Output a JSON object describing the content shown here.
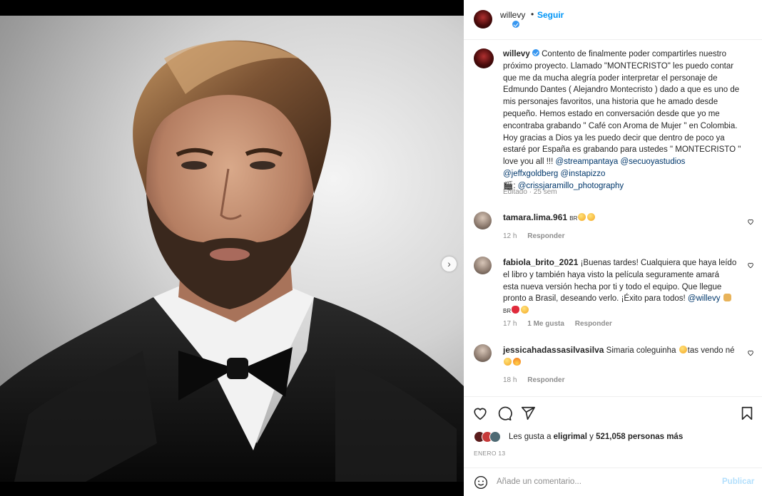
{
  "post": {
    "username": "willevy",
    "separator": "•",
    "follow_label": "Seguir",
    "more_label": "···"
  },
  "caption": {
    "username": "willevy",
    "text_before": "Contento de finalmente poder compartirles nuestro\npróximo proyecto. Llamado \"MONTECRISTO\" les puedo contar\nque me da mucha alegría poder interpretar el personaje de\nEdmundo Dantes ( Alejandro Montecristo ) dado a que es uno de\nmis personajes favoritos, una historia que he amado desde\npequeño. Hemos estado en conversación desde que yo me\nencontraba grabando \" Café con Aroma de Mujer \" en Colombia.\nHoy gracias a Dios ya les puedo decir que dentro de poco ya\nestaré por España es grabando para ustedes \" MONTECRISTO \"\nlove you all !!! ",
    "mention_1": "@streampantaya",
    "mention_2": "@secuoyastudios",
    "mention_3": "@jeffxgoldberg",
    "mention_4": "@instapizzo",
    "clapper": "🎬: ",
    "mention_5": "@crissjaramillo_photography",
    "edited": "Editado · 25 sem"
  },
  "comments": [
    {
      "username": "tamara.lima.961",
      "text": "BR",
      "time": "12 h",
      "reply": "Responder"
    },
    {
      "username": "fabiola_brito_2021",
      "text": "¡Buenas tardes! Cualquiera que haya leído\nel libro y también haya visto la película seguramente amará\nesta nueva versión hecha por ti y todo el equipo. Que llegue\npronto a Brasil, deseando verlo. ¡Éxito para todos! ",
      "mention": "@willevy",
      "flag": "BR",
      "time": "17 h",
      "likes": "1 Me gusta",
      "reply": "Responder"
    },
    {
      "username": "jessicahadassasilvasilva",
      "text": "Simaria coleguinha ",
      "text_after": "tas vendo né",
      "time": "18 h",
      "reply": "Responder"
    }
  ],
  "likes": {
    "prefix": "Les gusta a ",
    "user": "eligrimal",
    "middle": " y ",
    "count": "521,058 personas más"
  },
  "date": "ENERO 13",
  "add_comment": {
    "placeholder": "Añade un comentario...",
    "publish_label": "Publicar"
  },
  "icons": {
    "like": "heart-icon",
    "comment": "comment-icon",
    "share": "paper-plane-icon",
    "save": "bookmark-icon",
    "emoji": "smiley-icon",
    "next": "chevron-right-icon"
  },
  "colors": {
    "link": "#0095f6",
    "mention": "#00376b",
    "muted": "#8e8e8e",
    "verified": "#3897f0"
  }
}
